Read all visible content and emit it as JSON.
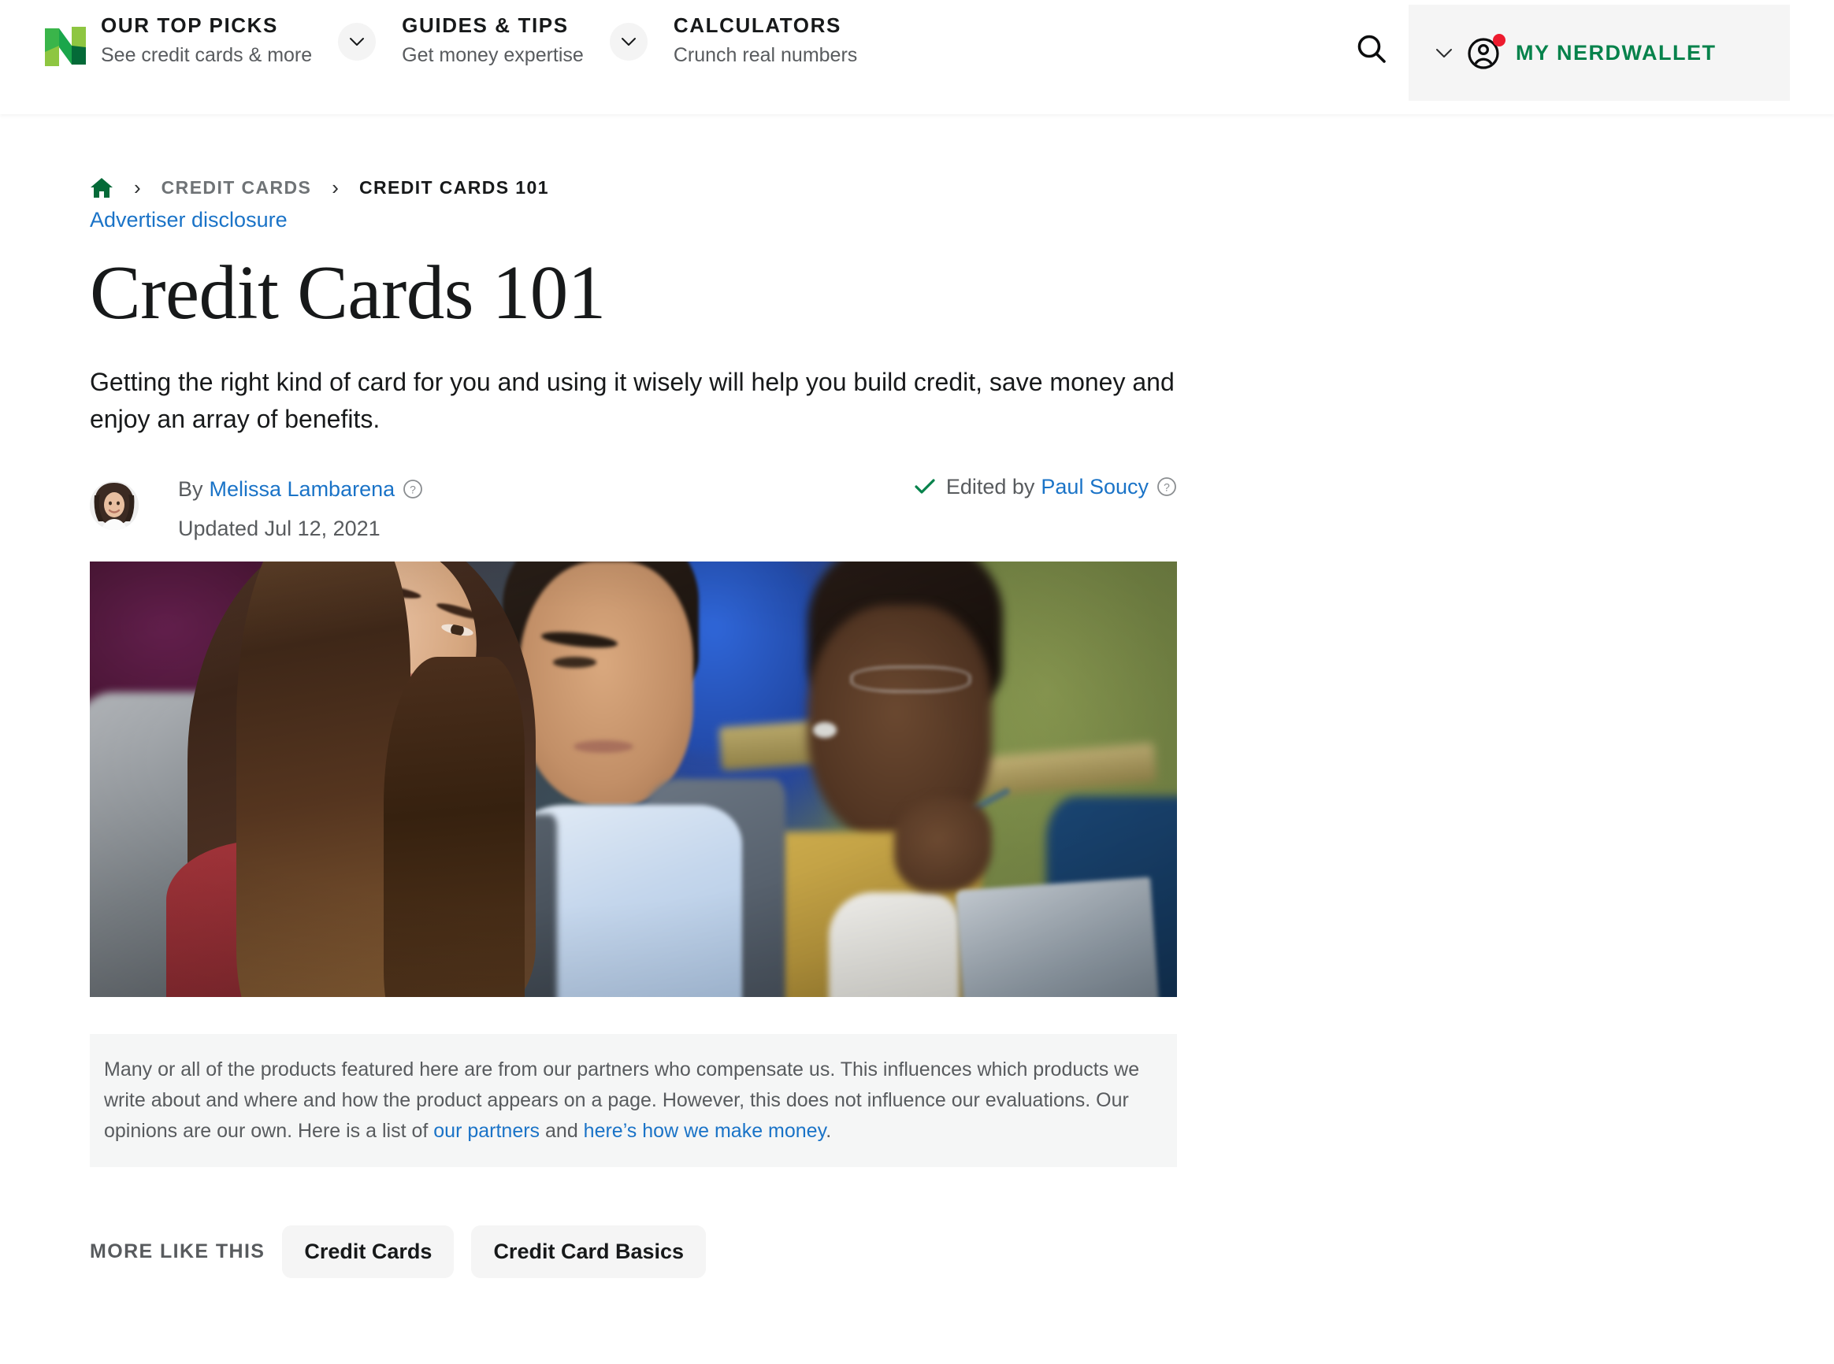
{
  "header": {
    "logo_name": "nerdwallet-logo",
    "nav": [
      {
        "title": "OUR TOP PICKS",
        "subtitle": "See credit cards & more"
      },
      {
        "title": "GUIDES & TIPS",
        "subtitle": "Get money expertise"
      },
      {
        "title": "CALCULATORS",
        "subtitle": "Crunch real numbers"
      }
    ],
    "search_label": "search-icon",
    "my_nerdwallet_label": "MY NERDWALLET",
    "notification_color": "#ed1b2e",
    "brand_green": "#06824b"
  },
  "breadcrumb": {
    "home_label": "Home",
    "separator": "›",
    "items": [
      {
        "label": "CREDIT CARDS",
        "current": false
      },
      {
        "label": "CREDIT CARDS 101",
        "current": true
      }
    ]
  },
  "article": {
    "advertiser_disclosure": "Advertiser disclosure",
    "title": "Credit Cards 101",
    "subtitle": "Getting the right kind of card for you and using it wisely will help you build credit, save money and enjoy an array of benefits.",
    "byline": {
      "by_prefix": "By",
      "author": "Melissa Lambarena",
      "updated": "Updated Jul 12, 2021",
      "edited_prefix": "Edited by",
      "editor": "Paul Soucy",
      "check_color": "#06824b",
      "link_color": "#1a73c7"
    },
    "hero_alt": "Three students sitting in a lecture hall"
  },
  "disclosure": {
    "text_part1": "Many or all of the products featured here are from our partners who compensate us. This influences which products we write about and where and how the product appears on a page. However, this does not influence our evaluations. Our opinions are our own. Here is a list of ",
    "link1": "our partners",
    "text_part2": " and ",
    "link2": "here’s how we make money",
    "text_part3": "."
  },
  "more_like_this": {
    "label": "MORE LIKE THIS",
    "tags": [
      "Credit Cards",
      "Credit Card Basics"
    ]
  }
}
